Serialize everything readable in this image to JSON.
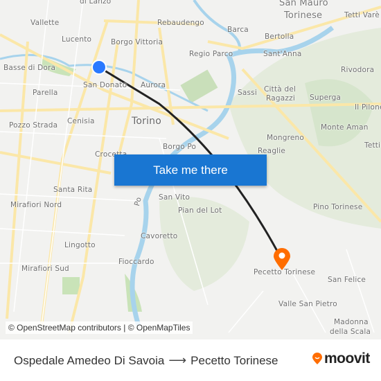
{
  "map": {
    "labels": [
      "di Lanzo",
      "Vallette",
      "Lucento",
      "Borgo Vittoria",
      "Rebaudengo",
      "Barca",
      "Bertolla",
      "San Mauro",
      "Torinese",
      "Tetti Varè",
      "Regio Parco",
      "Sant'Anna",
      "Rivodora",
      "Basse di Dora",
      "San Donato",
      "Aurora",
      "Sassi",
      "Città del",
      "Ragazzi",
      "Superga",
      "Il Pilone",
      "Parella",
      "Torino",
      "Pozzo Strada",
      "Cenisia",
      "Monte Aman",
      "Mongreno",
      "Reaglie",
      "Tetti",
      "Borgo Po",
      "Crocetta",
      "Santa Rita",
      "San Vito",
      "Pian del Lot",
      "Pino Torinese",
      "Mirafiori Nord",
      "Po",
      "Cavoretto",
      "Lingotto",
      "Fioccardo",
      "Mirafiori Sud",
      "Pecetto Torinese",
      "San Felice",
      "Valle San Pietro",
      "Madonna",
      "della Scala",
      "Po"
    ],
    "origin_color": "#2979ff",
    "destination_color": "#ff6d00",
    "route_color": "#222222",
    "origin_icon": "origin-dot-icon",
    "destination_icon": "map-pin-icon"
  },
  "cta": {
    "label": "Take me there",
    "color": "#1976d2"
  },
  "attribution": "© OpenStreetMap contributors | © OpenMapTiles",
  "footer": {
    "origin": "Ospedale Amedeo Di Savoia",
    "arrow_icon": "arrow-right-icon",
    "destination": "Pecetto Torinese",
    "logo_text": "moovit",
    "logo_color": "#ff6d00"
  }
}
